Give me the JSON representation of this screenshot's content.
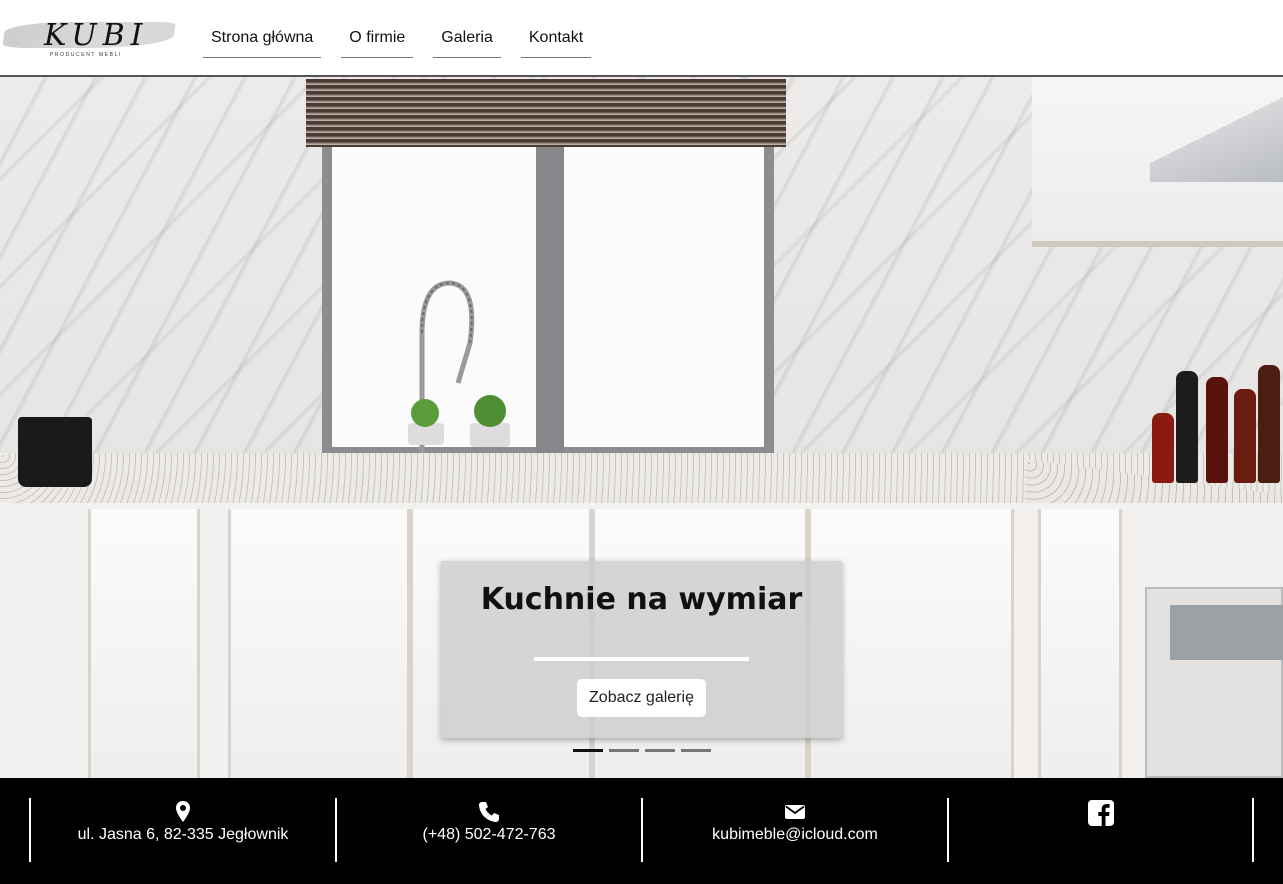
{
  "header": {
    "logo": {
      "word": "KUBI",
      "tagline": "PRODUCENT MEBLI"
    },
    "nav": [
      "Strona główna",
      "O firmie",
      "Galeria",
      "Kontakt"
    ]
  },
  "hero": {
    "title": "Kuchnie na wymiar",
    "button_label": "Zobacz galerię",
    "slides": {
      "count": 4,
      "active_index": 0
    }
  },
  "footer": {
    "address": {
      "icon": "map-pin-icon",
      "text": "ul. Jasna 6, 82-335 Jegłownik"
    },
    "phone": {
      "icon": "phone-icon",
      "text": "(+48) 502-472-763"
    },
    "email": {
      "icon": "envelope-icon",
      "text": "kubimeble@icloud.com"
    },
    "social": {
      "icon": "facebook-icon"
    }
  },
  "colors": {
    "header_bg": "#ffffff",
    "footer_bg": "#000000",
    "footer_text": "#ffffff",
    "accent_dark": "#111111"
  }
}
